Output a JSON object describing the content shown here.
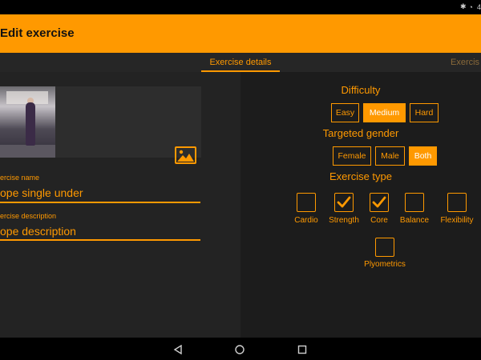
{
  "status_bar": {
    "time": "4"
  },
  "app_bar": {
    "title": "Edit exercise"
  },
  "tabs": [
    {
      "label": "Exercise details"
    },
    {
      "label": "Exercis"
    }
  ],
  "form": {
    "name_label": "ercise name",
    "name_value": "ope single under",
    "description_label": "ercise description",
    "description_value": "ope description"
  },
  "difficulty": {
    "title": "Difficulty",
    "options": [
      "Easy",
      "Medium",
      "Hard"
    ],
    "selected": "Medium"
  },
  "gender": {
    "title": "Targeted gender",
    "options": [
      "Female",
      "Male",
      "Both"
    ],
    "selected": "Both"
  },
  "exercise_type": {
    "title": "Exercise type",
    "items": [
      {
        "label": "Cardio",
        "checked": false
      },
      {
        "label": "Strength",
        "checked": true
      },
      {
        "label": "Core",
        "checked": true
      },
      {
        "label": "Balance",
        "checked": false
      },
      {
        "label": "Flexibility",
        "checked": false
      },
      {
        "label": "Plyometrics",
        "checked": false
      }
    ]
  },
  "colors": {
    "accent": "#ff9900",
    "background": "#1f1f1f"
  }
}
